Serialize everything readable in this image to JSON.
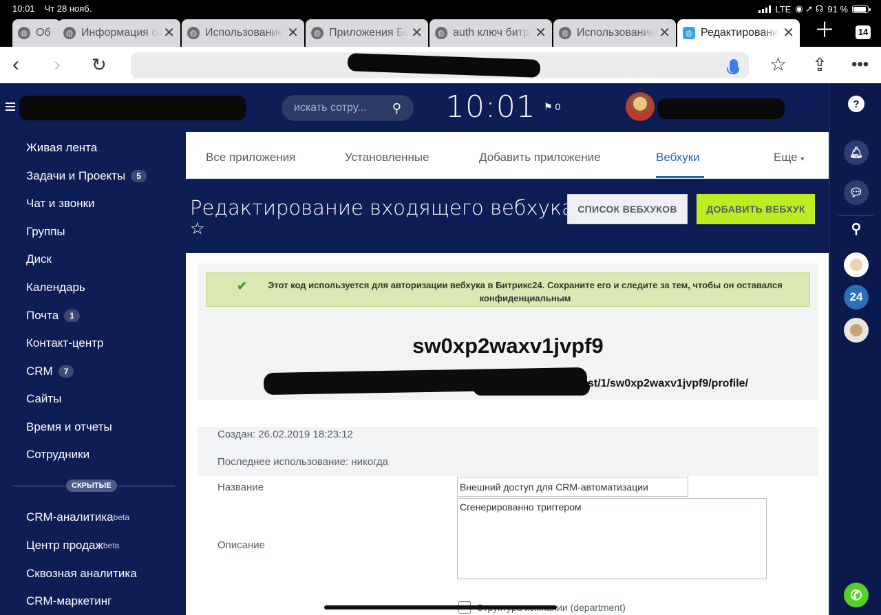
{
  "status_bar": {
    "time": "10:01",
    "date": "Чт 28 нояб.",
    "network": "LTE",
    "battery": "91 %"
  },
  "browser": {
    "tabs": [
      {
        "label": "Об"
      },
      {
        "label": "Информация о"
      },
      {
        "label": "Использование"
      },
      {
        "label": "Приложения Би"
      },
      {
        "label": "auth ключ битр"
      },
      {
        "label": "Использование"
      },
      {
        "label": "Редактировани",
        "active": true
      }
    ],
    "tab_count": "14"
  },
  "header": {
    "search_placeholder": "искать сотру...",
    "clock": "10:01",
    "flag_count": "0"
  },
  "sidebar": {
    "items": [
      {
        "label": "Живая лента"
      },
      {
        "label": "Задачи и Проекты",
        "count": "5"
      },
      {
        "label": "Чат и звонки"
      },
      {
        "label": "Группы"
      },
      {
        "label": "Диск"
      },
      {
        "label": "Календарь"
      },
      {
        "label": "Почта",
        "count": "1"
      },
      {
        "label": "Контакт-центр"
      },
      {
        "label": "CRM",
        "count": "7"
      },
      {
        "label": "Сайты"
      },
      {
        "label": "Время и отчеты"
      },
      {
        "label": "Сотрудники"
      }
    ],
    "hidden_label": "СКРЫТЫЕ",
    "hidden_items": [
      {
        "label": "CRM-аналитика",
        "sup": "beta"
      },
      {
        "label": "Центр продаж",
        "sup": "beta"
      },
      {
        "label": "Сквозная аналитика"
      },
      {
        "label": "CRM-маркетинг"
      }
    ]
  },
  "app_tabs": [
    "Все приложения",
    "Установленные",
    "Добавить приложение",
    "Вебхуки",
    "Еще"
  ],
  "page": {
    "title": "Редактирование входящего вебхука",
    "btn_list": "СПИСОК ВЕБХУКОВ",
    "btn_add": "ДОБАВИТЬ ВЕБХУК",
    "notice": "Этот код используется для авторизации вебхука в Битрикс24. Сохраните его и следите за тем, чтобы он оставался конфиденциальным",
    "key": "sw0xp2waxv1jvpf9",
    "url_tail": "ru/rest/1/sw0xp2waxv1jvpf9/profile/",
    "created": "Создан: 26.02.2019 18:23:12",
    "last_used": "Последнее использование: никогда",
    "name_label": "Название",
    "name_value": "Внешний доступ для CRM-автоматизации",
    "desc_label": "Описание",
    "desc_value": "Сгенерированно триггером",
    "perm_label": "Структура компании (department)"
  },
  "right_bar": {
    "bitrix_badge": "24"
  }
}
